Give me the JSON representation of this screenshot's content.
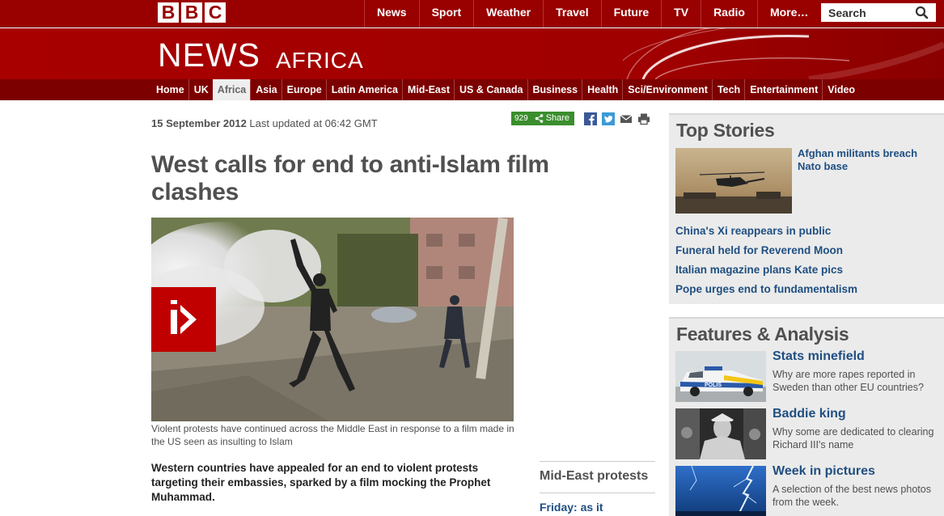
{
  "global_nav": {
    "logo_letters": [
      "B",
      "B",
      "C"
    ],
    "items": [
      "News",
      "Sport",
      "Weather",
      "Travel",
      "Future",
      "TV",
      "Radio",
      "More…"
    ],
    "search_placeholder": "Search"
  },
  "banner": {
    "title": "NEWS",
    "region": "AFRICA"
  },
  "section_nav": {
    "items": [
      "Home",
      "UK",
      "Africa",
      "Asia",
      "Europe",
      "Latin America",
      "Mid-East",
      "US & Canada",
      "Business",
      "Health",
      "Sci/Environment",
      "Tech",
      "Entertainment",
      "Video"
    ],
    "active": "Africa"
  },
  "article": {
    "date": "15 September 2012",
    "updated": "Last updated at 06:42 GMT",
    "share_count": "929",
    "share_label": "Share",
    "headline": "West calls for end to anti-Islam film clashes",
    "caption": "Violent protests have continued across the Middle East in response to a film made in the US seen as insulting to Islam",
    "intro": "Western countries have appealed for an end to violent protests targeting their embassies, sparked by a film mocking the Prophet Muhammad."
  },
  "related": {
    "title": "Mid-East protests",
    "link": "Friday: as it"
  },
  "top_stories": {
    "title": "Top Stories",
    "lead": "Afghan militants breach Nato base",
    "links": [
      "China's Xi reappears in public",
      "Funeral held for Reverend Moon",
      "Italian magazine plans Kate pics",
      "Pope urges end to fundamentalism"
    ]
  },
  "features": {
    "title": "Features & Analysis",
    "items": [
      {
        "title": "Stats minefield",
        "desc": "Why are more rapes reported in Sweden than other EU countries?"
      },
      {
        "title": "Baddie king",
        "desc": "Why some are dedicated to clearing Richard III's name"
      },
      {
        "title": "Week in pictures",
        "desc": "A selection of the best news photos from the week."
      }
    ]
  },
  "colors": {
    "brand_red": "#990000",
    "link_blue": "#1f4f82",
    "share_green": "#3b8e2e"
  }
}
